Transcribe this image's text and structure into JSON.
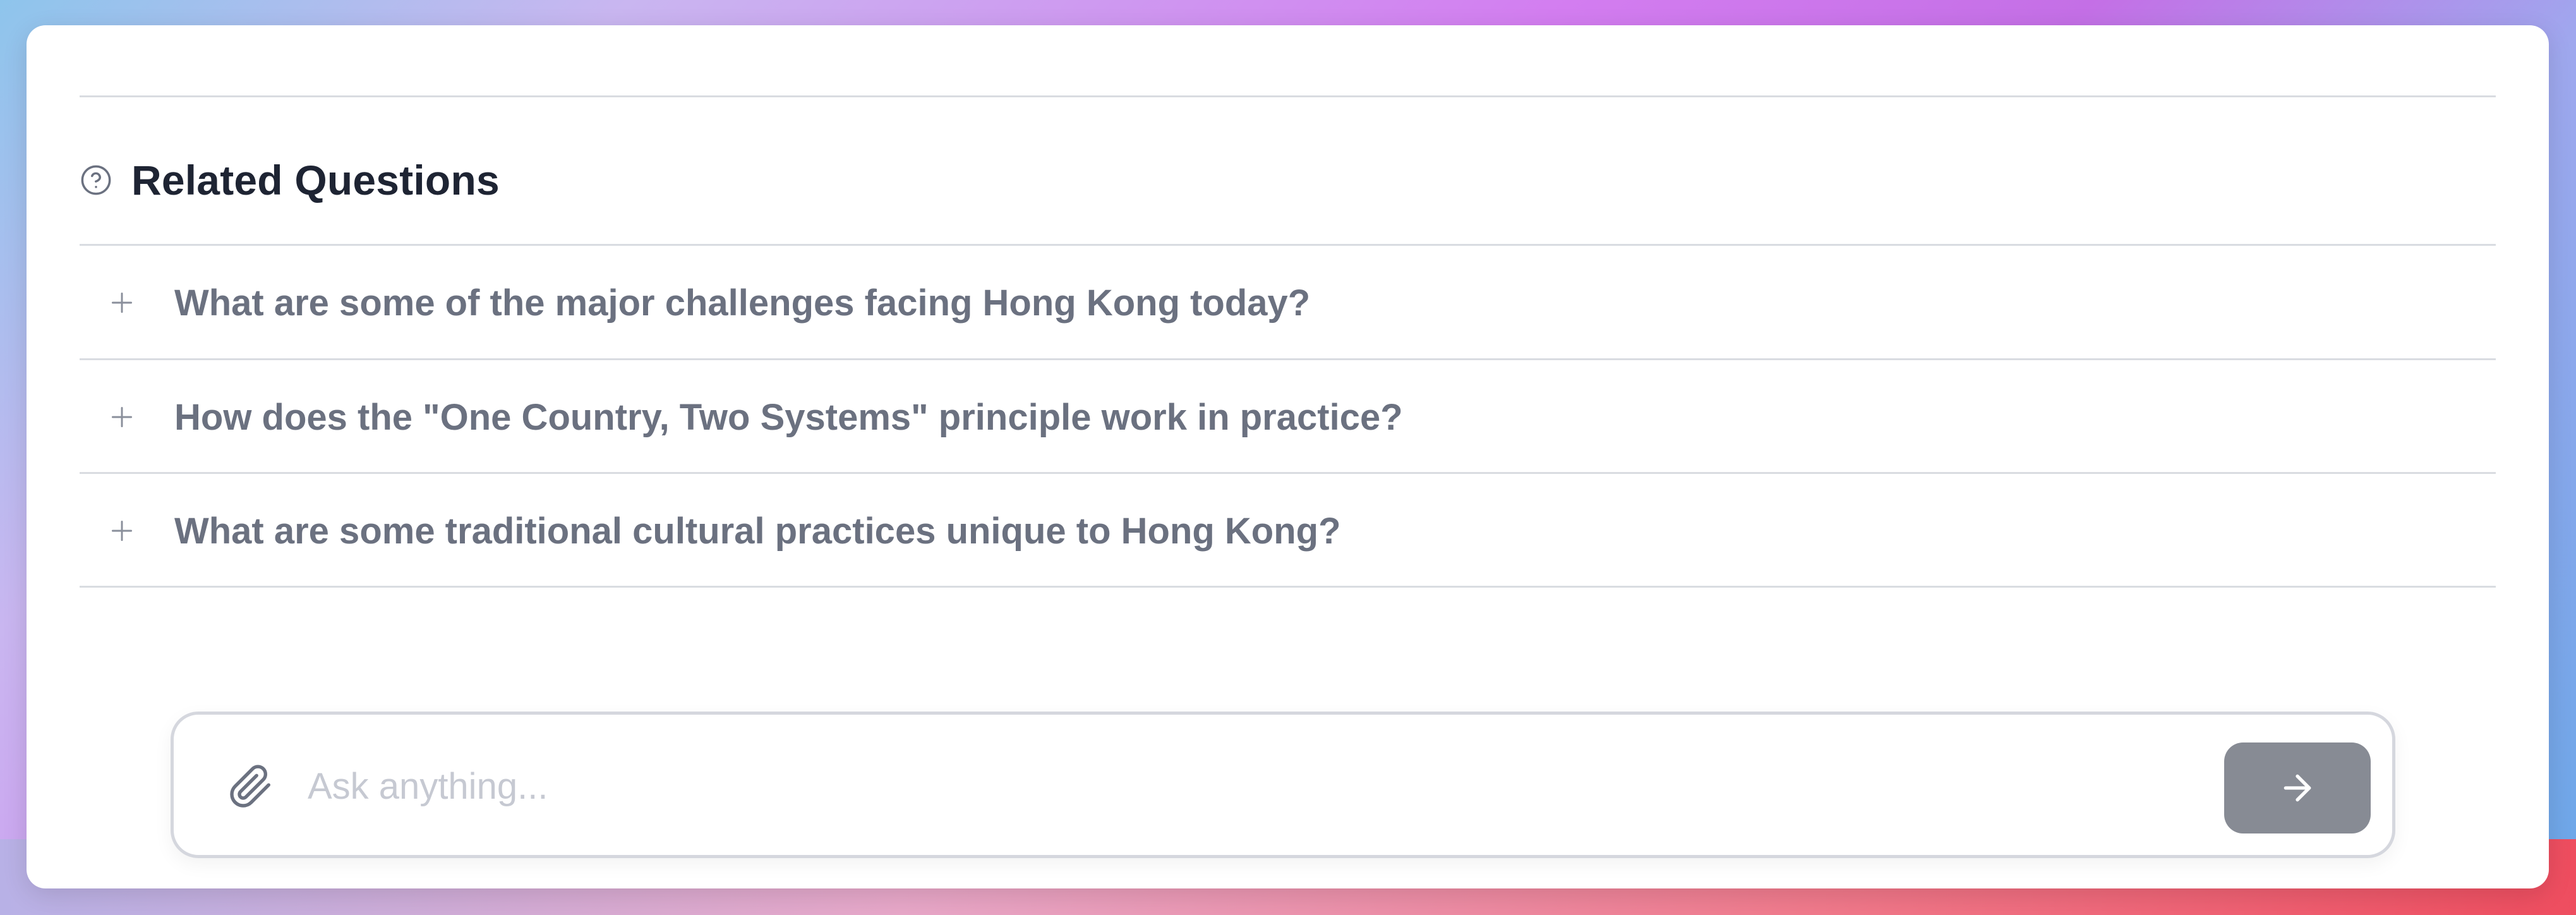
{
  "related": {
    "title": "Related Questions",
    "questions": [
      "What are some of the major challenges facing Hong Kong today?",
      "How does the \"One Country, Two Systems\" principle work in practice?",
      "What are some traditional cultural practices unique to Hong Kong?"
    ]
  },
  "composer": {
    "placeholder": "Ask anything...",
    "value": ""
  },
  "icons": {
    "header": "help-circle-icon",
    "row": "plus-icon",
    "attach": "paperclip-icon",
    "send": "arrow-right-icon"
  },
  "colors": {
    "title": "#1e2433",
    "question_text": "#6b7180",
    "divider": "#d9dce1",
    "send_button": "#878b94",
    "placeholder": "#c6c9d2"
  }
}
